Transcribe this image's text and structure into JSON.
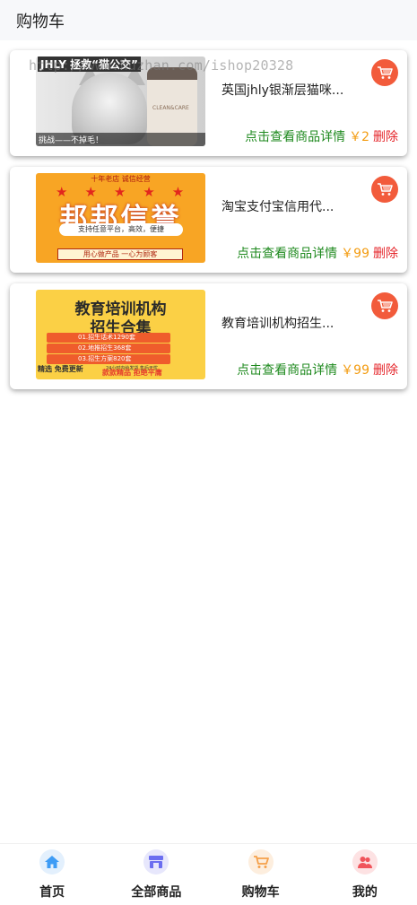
{
  "header": {
    "title": "购物车"
  },
  "watermark": "http://www.huzhan.com/ishop20328",
  "items": [
    {
      "title": "英国jhly银渐层猫咪...",
      "detail_label": "点击查看商品详情",
      "price": "￥2",
      "delete_label": "删除",
      "image_text": {
        "brand": "JHLY 拯救“猫公交”",
        "caption": "挑战——不掉毛！",
        "bottle": "CLEAN&CARE"
      }
    },
    {
      "title": "淘宝支付宝信用代...",
      "detail_label": "点击查看商品详情",
      "price": "￥99",
      "delete_label": "删除",
      "image_text": {
        "top": "十年老店 诚信经营",
        "stars": "★★★★★",
        "headline": "邦邦信誉",
        "pill": "支持任意平台，高效，便捷",
        "foot": "用心做产品 一心为顾客"
      }
    },
    {
      "title": "教育培训机构招生...",
      "detail_label": "点击查看商品详情",
      "price": "￥99",
      "delete_label": "删除",
      "image_text": {
        "line1": "教育培训机构",
        "line2": "招生合集",
        "bar1": "01.招生话术1290套",
        "bar2": "02.地推招生368套",
        "bar3": "03.招生方案820套",
        "mini": "24小时内给发货 售后无忧",
        "left": "精选 免费更新",
        "bottom": "款款精品 拒绝平庸"
      }
    }
  ],
  "tabbar": [
    {
      "label": "首页",
      "icon": "home-icon",
      "color": "#3e9cf5"
    },
    {
      "label": "全部商品",
      "icon": "store-icon",
      "color": "#6b6ef0"
    },
    {
      "label": "购物车",
      "icon": "cart-icon",
      "color": "#f5a04a"
    },
    {
      "label": "我的",
      "icon": "user-icon",
      "color": "#f0545b"
    }
  ],
  "colors": {
    "cart_button": "#f25b3b",
    "detail_link": "#1f8a1f",
    "price": "#f39c12",
    "delete": "#e5262b"
  }
}
